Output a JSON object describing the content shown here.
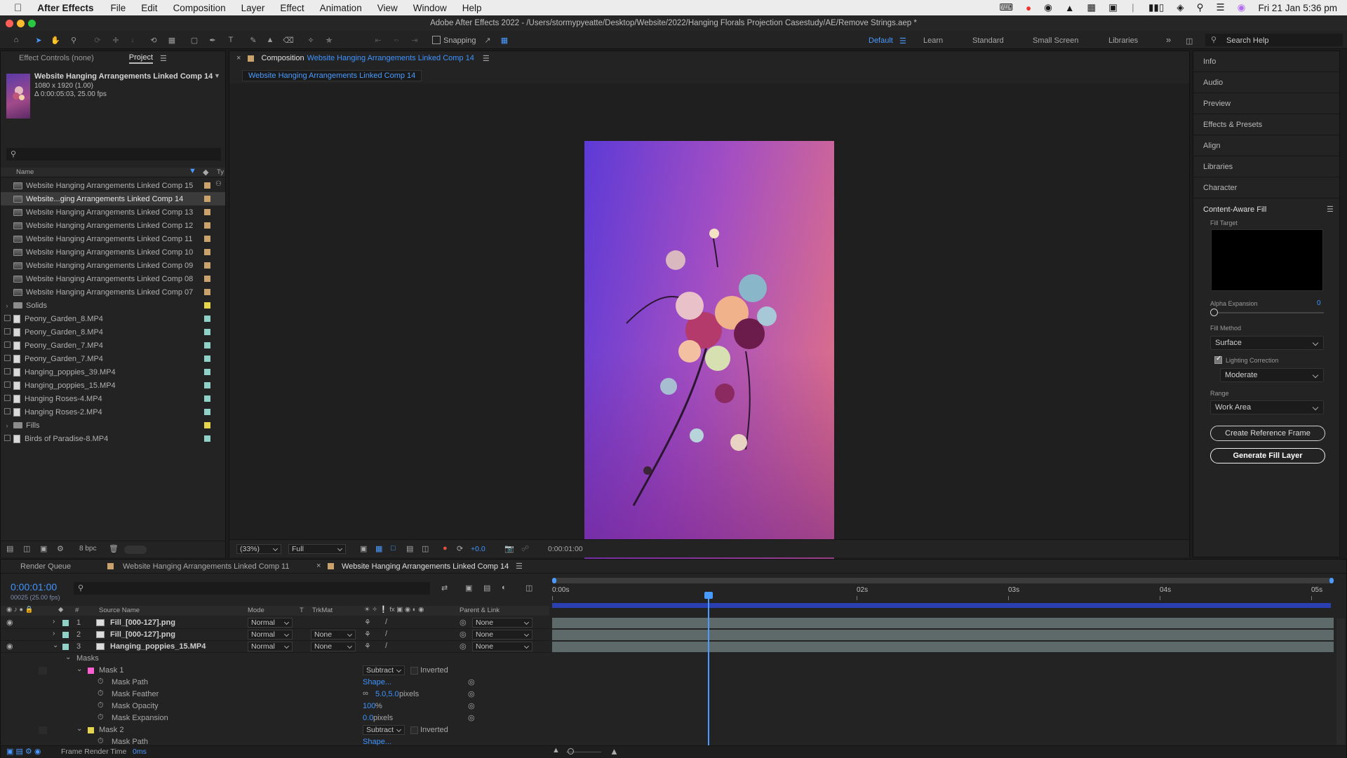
{
  "menubar": {
    "app": "After Effects",
    "items": [
      "File",
      "Edit",
      "Composition",
      "Layer",
      "Effect",
      "Animation",
      "View",
      "Window",
      "Help"
    ],
    "datetime": "Fri 21 Jan  5:36 pm"
  },
  "window_title": "Adobe After Effects 2022 - /Users/stormypyeatte/Desktop/Website/2022/Hanging Florals Projection Casestudy/AE/Remove Strings.aep *",
  "toolbar": {
    "snapping": "Snapping",
    "workspaces": [
      "Default",
      "Learn",
      "Standard",
      "Small Screen",
      "Libraries"
    ],
    "search_placeholder": "Search Help"
  },
  "project_panel": {
    "tab_effect_controls": "Effect Controls (none)",
    "tab_project": "Project",
    "preview_name": "Website Hanging Arrangements Linked Comp 14",
    "preview_size": "1080 x 1920 (1.00)",
    "preview_duration": "Δ 0:00:05:03, 25.00 fps",
    "col_name": "Name",
    "col_type": "Ty",
    "bpc": "8 bpc",
    "items": [
      {
        "name": "Website Hanging Arrangements Linked Comp 15",
        "kind": "comp",
        "color": "#c9a36b"
      },
      {
        "name": "Website...ging Arrangements Linked Comp 14",
        "kind": "comp",
        "color": "#c9a36b"
      },
      {
        "name": "Website Hanging Arrangements Linked Comp 13",
        "kind": "comp",
        "color": "#c9a36b"
      },
      {
        "name": "Website Hanging Arrangements Linked Comp 12",
        "kind": "comp",
        "color": "#c9a36b"
      },
      {
        "name": "Website Hanging Arrangements Linked Comp 11",
        "kind": "comp",
        "color": "#c9a36b"
      },
      {
        "name": "Website Hanging Arrangements Linked Comp 10",
        "kind": "comp",
        "color": "#c9a36b"
      },
      {
        "name": "Website Hanging Arrangements Linked Comp 09",
        "kind": "comp",
        "color": "#c9a36b"
      },
      {
        "name": "Website Hanging Arrangements Linked Comp 08",
        "kind": "comp",
        "color": "#c9a36b"
      },
      {
        "name": "Website Hanging Arrangements Linked Comp 07",
        "kind": "comp",
        "color": "#c9a36b"
      },
      {
        "name": "Solids",
        "kind": "folder",
        "color": "#e5d54e"
      },
      {
        "name": "Peony_Garden_8.MP4",
        "kind": "file",
        "color": "#8fd1c7"
      },
      {
        "name": "Peony_Garden_8.MP4",
        "kind": "file",
        "color": "#8fd1c7"
      },
      {
        "name": "Peony_Garden_7.MP4",
        "kind": "file",
        "color": "#8fd1c7"
      },
      {
        "name": "Peony_Garden_7.MP4",
        "kind": "file",
        "color": "#8fd1c7"
      },
      {
        "name": "Hanging_poppies_39.MP4",
        "kind": "file",
        "color": "#8fd1c7"
      },
      {
        "name": "Hanging_poppies_15.MP4",
        "kind": "file",
        "color": "#8fd1c7"
      },
      {
        "name": "Hanging Roses-4.MP4",
        "kind": "file",
        "color": "#8fd1c7"
      },
      {
        "name": "Hanging Roses-2.MP4",
        "kind": "file",
        "color": "#8fd1c7"
      },
      {
        "name": "Fills",
        "kind": "folder",
        "color": "#e5d54e"
      },
      {
        "name": "Birds of Paradise-8.MP4",
        "kind": "file",
        "color": "#8fd1c7"
      }
    ]
  },
  "composition": {
    "tab_prefix": "Composition",
    "tab_name": "Website Hanging Arrangements Linked Comp 14",
    "breadcrumb": "Website Hanging Arrangements Linked Comp 14",
    "zoom": "(33%)",
    "resolution": "Full",
    "exposure": "+0.0",
    "timecode": "0:00:01:00"
  },
  "right_panels": {
    "items": [
      "Info",
      "Audio",
      "Preview",
      "Effects & Presets",
      "Align",
      "Libraries",
      "Character"
    ],
    "caf": {
      "title": "Content-Aware Fill",
      "fill_target": "Fill Target",
      "alpha_expansion": "Alpha Expansion",
      "alpha_value": "0",
      "fill_method_label": "Fill Method",
      "fill_method": "Surface",
      "lighting_correction": "Lighting Correction",
      "lighting_value": "Moderate",
      "range_label": "Range",
      "range_value": "Work Area",
      "create_ref": "Create Reference Frame",
      "generate": "Generate Fill Layer"
    }
  },
  "timeline": {
    "tabs": [
      "Render Queue",
      "Website Hanging Arrangements Linked Comp 11",
      "Website Hanging Arrangements Linked Comp 14"
    ],
    "timecode": "0:00:01:00",
    "frame_info": "00025 (25.00 fps)",
    "columns": {
      "source": "Source Name",
      "mode": "Mode",
      "t": "T",
      "trkmat": "TrkMat",
      "parent": "Parent & Link",
      "num": "#"
    },
    "ruler": [
      "0:00s",
      "02s",
      "03s",
      "04s",
      "05s"
    ],
    "current_time_fraction": 0.2,
    "layers": [
      {
        "num": "1",
        "name": "Fill_[000-127].png",
        "mode": "Normal",
        "trkmat": "",
        "parent": "None",
        "color": "#8fd1c7"
      },
      {
        "num": "2",
        "name": "Fill_[000-127].png",
        "mode": "Normal",
        "trkmat": "None",
        "parent": "None",
        "color": "#8fd1c7"
      },
      {
        "num": "3",
        "name": "Hanging_poppies_15.MP4",
        "mode": "Normal",
        "trkmat": "None",
        "parent": "None",
        "color": "#8fd1c7"
      }
    ],
    "masks_label": "Masks",
    "mask1": {
      "name": "Mask 1",
      "mode": "Subtract",
      "inverted": "Inverted",
      "color": "#ff5fd1"
    },
    "props": [
      {
        "name": "Mask Path",
        "value": "Shape...",
        "unit": ""
      },
      {
        "name": "Mask Feather",
        "value": "5.0,5.0",
        "unit": " pixels"
      },
      {
        "name": "Mask Opacity",
        "value": "100",
        "unit": "%"
      },
      {
        "name": "Mask Expansion",
        "value": "0.0",
        "unit": " pixels"
      }
    ],
    "mask2": {
      "name": "Mask 2",
      "mode": "Subtract",
      "inverted": "Inverted",
      "color": "#e5d54e"
    },
    "mask2_path": {
      "name": "Mask Path",
      "value": "Shape..."
    },
    "status_label": "Frame Render Time",
    "status_value": "0ms"
  }
}
